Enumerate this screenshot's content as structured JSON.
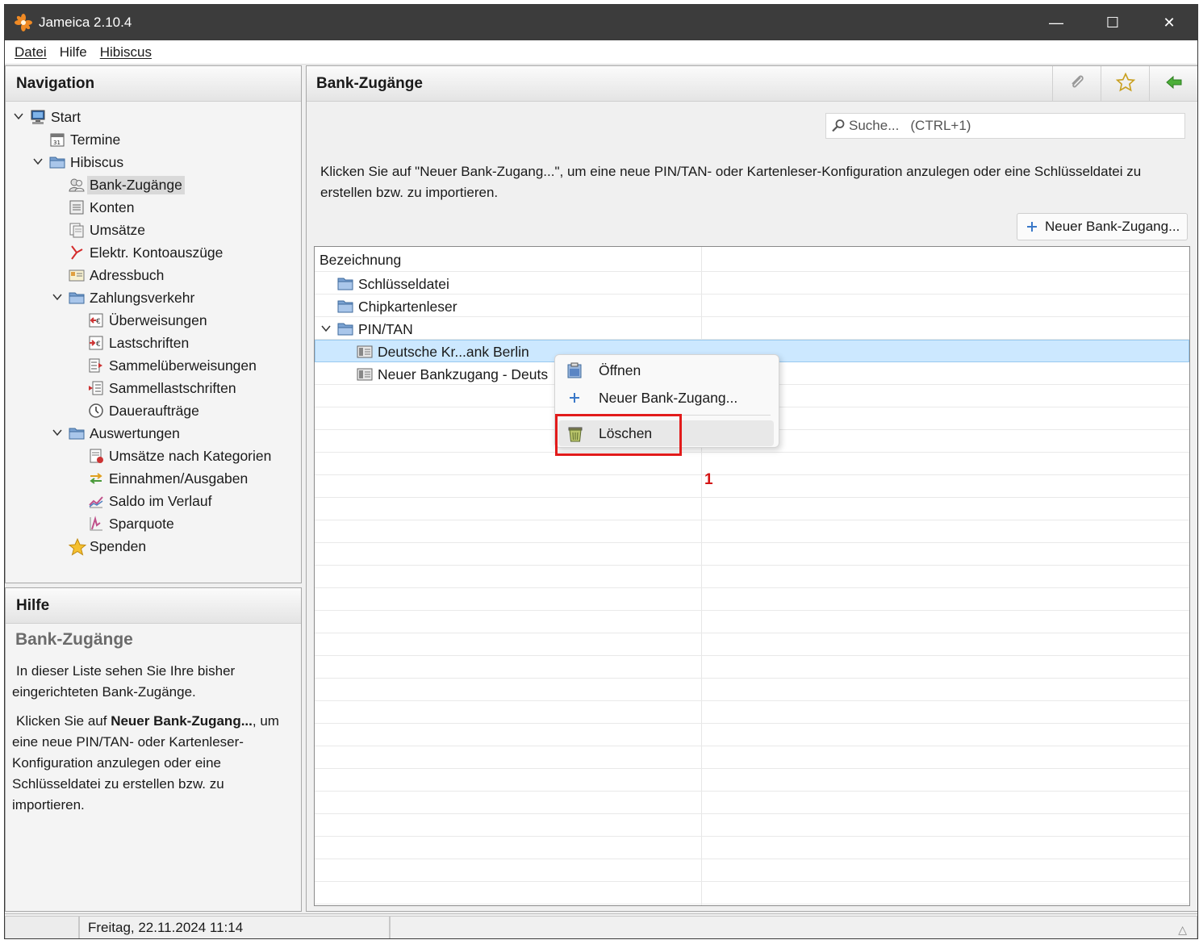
{
  "window": {
    "title": "Jameica 2.10.4",
    "controls": [
      "—",
      "☐",
      "✕"
    ]
  },
  "menubar": {
    "items": [
      "Datei",
      "Hilfe",
      "Hibiscus"
    ]
  },
  "navigation": {
    "title": "Navigation",
    "items": [
      {
        "label": "Start",
        "icon": "computer-icon",
        "expanded": true
      },
      {
        "label": "Termine",
        "icon": "calendar-icon"
      },
      {
        "label": "Hibiscus",
        "icon": "folder-icon",
        "expanded": true
      },
      {
        "label": "Bank-Zugänge",
        "icon": "users-icon",
        "selected": true
      },
      {
        "label": "Konten",
        "icon": "account-icon"
      },
      {
        "label": "Umsätze",
        "icon": "transactions-icon"
      },
      {
        "label": "Elektr. Kontoauszüge",
        "icon": "pdf-icon"
      },
      {
        "label": "Adressbuch",
        "icon": "addressbook-icon"
      },
      {
        "label": "Zahlungsverkehr",
        "icon": "folder-icon",
        "expanded": true
      },
      {
        "label": "Überweisungen",
        "icon": "transfer-icon"
      },
      {
        "label": "Lastschriften",
        "icon": "debit-icon"
      },
      {
        "label": "Sammelüberweisungen",
        "icon": "batch-transfer-icon"
      },
      {
        "label": "Sammellastschriften",
        "icon": "batch-debit-icon"
      },
      {
        "label": "Daueraufträge",
        "icon": "clock-icon"
      },
      {
        "label": "Auswertungen",
        "icon": "folder-icon",
        "expanded": true
      },
      {
        "label": "Umsätze nach Kategorien",
        "icon": "category-report-icon"
      },
      {
        "label": "Einnahmen/Ausgaben",
        "icon": "income-expense-icon"
      },
      {
        "label": "Saldo im Verlauf",
        "icon": "balance-chart-icon"
      },
      {
        "label": "Sparquote",
        "icon": "savings-chart-icon"
      },
      {
        "label": "Spenden",
        "icon": "star-icon"
      }
    ]
  },
  "help": {
    "title": "Hilfe",
    "heading": "Bank-Zugänge",
    "para1": "In dieser Liste sehen Sie Ihre bisher eingerichteten Bank-Zugänge.",
    "para2_prefix": "Klicken Sie auf ",
    "para2_bold": "Neuer Bank-Zugang...",
    "para2_suffix": ", um eine neue PIN/TAN- oder Kartenleser-Konfiguration anzulegen oder eine Schlüsseldatei zu erstellen bzw. zu importieren."
  },
  "main": {
    "title": "Bank-Zugänge",
    "header_buttons": [
      "attach-icon",
      "favorite-star-icon",
      "back-arrow-icon"
    ],
    "search": {
      "placeholder": "Suche...",
      "shortcut": "(CTRL+1)"
    },
    "intro": "Klicken Sie auf \"Neuer Bank-Zugang...\", um eine neue PIN/TAN- oder Kartenleser-Konfiguration anzulegen oder eine Schlüsseldatei zu erstellen bzw. zu importieren.",
    "new_button": "Neuer Bank-Zugang...",
    "table": {
      "column": "Bezeichnung",
      "rows": [
        {
          "label": "Schlüsseldatei",
          "icon": "folder-icon"
        },
        {
          "label": "Chipkartenleser",
          "icon": "folder-icon"
        },
        {
          "label": "PIN/TAN",
          "icon": "folder-open-icon",
          "expanded": true
        },
        {
          "label": "Deutsche Kr...ank Berlin",
          "icon": "bank-card-icon",
          "selected": true
        },
        {
          "label": "Neuer Bankzugang - Deuts",
          "icon": "bank-card-icon"
        }
      ]
    }
  },
  "context_menu": {
    "items": [
      {
        "label": "Öffnen",
        "icon": "open-clipboard-icon"
      },
      {
        "label": "Neuer Bank-Zugang...",
        "icon": "plus-icon"
      },
      {
        "label": "Löschen",
        "icon": "trash-icon",
        "highlighted": true
      }
    ]
  },
  "annotation": {
    "marker": "1",
    "color": "#e21b1b"
  },
  "statusbar": {
    "datetime": "Freitag, 22.11.2024 11:14"
  }
}
